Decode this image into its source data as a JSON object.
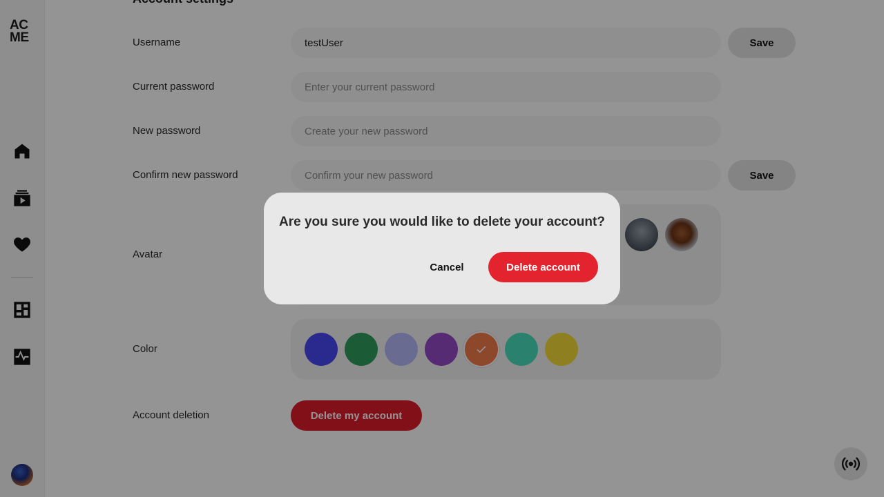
{
  "brand": {
    "logo_line1": "AC",
    "logo_line2": "ME"
  },
  "sidebar": {
    "items": [
      {
        "icon": "home-icon"
      },
      {
        "icon": "video-library-icon"
      },
      {
        "icon": "heart-icon"
      },
      {
        "icon": "dashboard-icon"
      },
      {
        "icon": "activity-icon"
      }
    ]
  },
  "page": {
    "title": "Account settings"
  },
  "form": {
    "username": {
      "label": "Username",
      "value": "testUser",
      "save_label": "Save"
    },
    "current_password": {
      "label": "Current password",
      "placeholder": "Enter your current password"
    },
    "new_password": {
      "label": "New password",
      "placeholder": "Create your new password"
    },
    "confirm_password": {
      "label": "Confirm new password",
      "placeholder": "Confirm your new password",
      "save_label": "Save"
    },
    "avatar": {
      "label": "Avatar"
    },
    "color": {
      "label": "Color",
      "swatches": [
        "#4949f5",
        "#2f9e5c",
        "#b7b8fa",
        "#9749c8",
        "#f37a4b",
        "#49e0be",
        "#f5dd3a"
      ],
      "selected_index": 4
    },
    "deletion": {
      "label": "Account deletion",
      "button_label": "Delete my account"
    }
  },
  "modal": {
    "title": "Are you sure you would like to delete your account?",
    "cancel_label": "Cancel",
    "confirm_label": "Delete account"
  },
  "colors": {
    "danger": "#e3242e",
    "overlay": "rgba(0,0,0,0.42)"
  }
}
